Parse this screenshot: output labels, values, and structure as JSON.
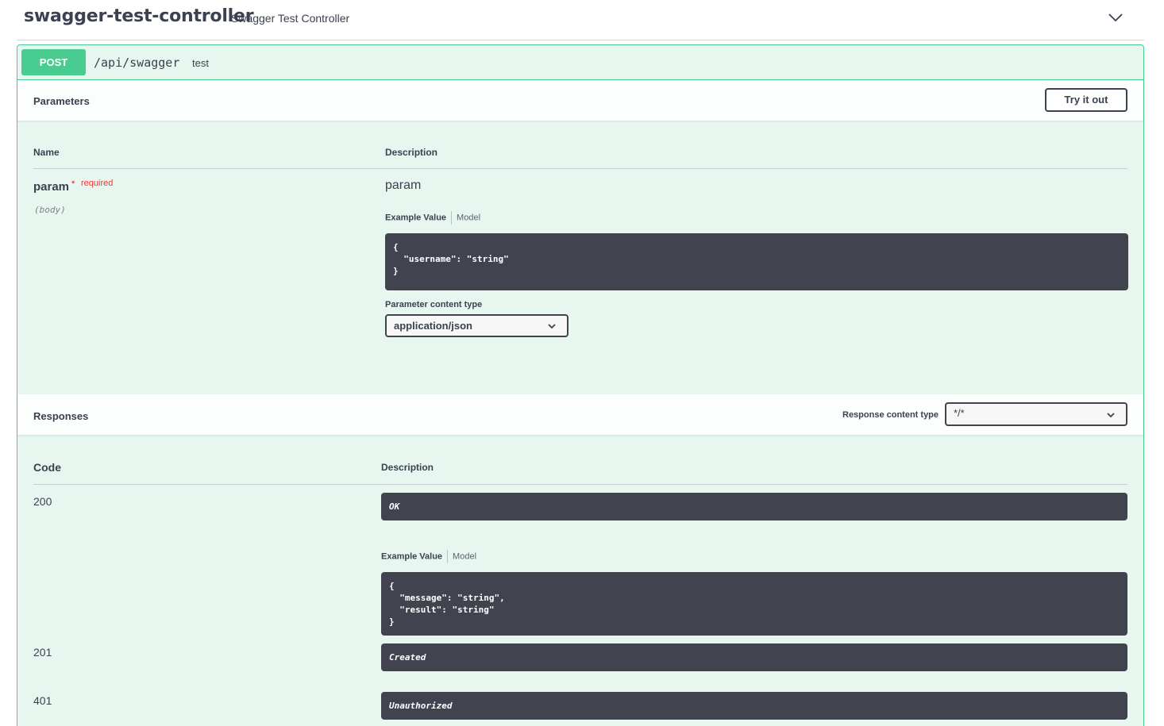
{
  "tag": {
    "name": "swagger-test-controller",
    "description": "Swagger Test Controller",
    "toggle_icon": "chevron-down-icon"
  },
  "operation": {
    "method": "POST",
    "path": "/api/swagger",
    "summary": "test",
    "color": "#49cc90"
  },
  "parameters": {
    "title": "Parameters",
    "try_label": "Try it out",
    "col_name": "Name",
    "col_description": "Description",
    "items": [
      {
        "name": "param",
        "required_star": "*",
        "required_label": "required",
        "in": "(body)",
        "description": "param",
        "tab_example": "Example Value",
        "tab_model": "Model",
        "example": "{\n  \"username\": \"string\"\n}",
        "content_type_label": "Parameter content type",
        "content_type": "application/json"
      }
    ]
  },
  "responses": {
    "title": "Responses",
    "content_type_label": "Response content type",
    "content_type": "*/*",
    "col_code": "Code",
    "col_description": "Description",
    "items": [
      {
        "code": "200",
        "description": "OK",
        "tab_example": "Example Value",
        "tab_model": "Model",
        "example": "{\n  \"message\": \"string\",\n  \"result\": \"string\"\n}"
      },
      {
        "code": "201",
        "description": "Created"
      },
      {
        "code": "401",
        "description": "Unauthorized"
      }
    ]
  }
}
